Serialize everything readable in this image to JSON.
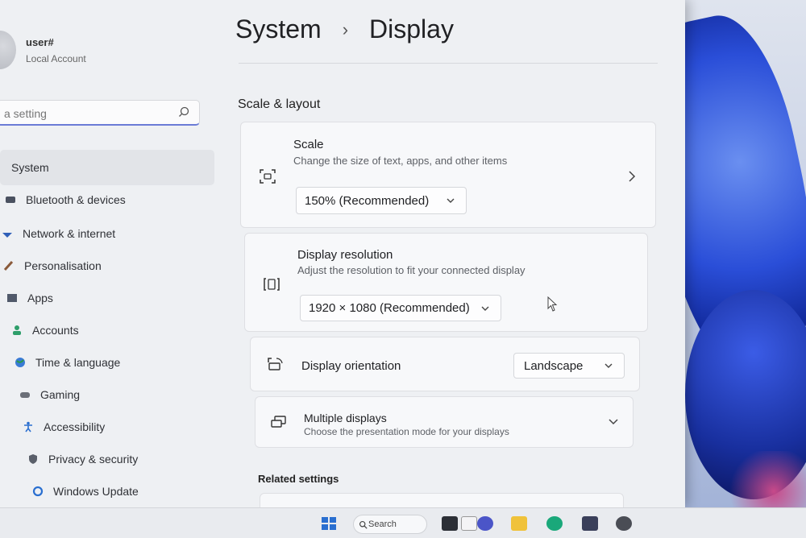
{
  "window": {
    "background": "#eef0f3"
  },
  "user": {
    "name": "user#",
    "account_type": "Local Account"
  },
  "search": {
    "placeholder": "Find a setting",
    "value": "a setting"
  },
  "nav": {
    "items": [
      {
        "label": "System",
        "icon": "monitor-icon",
        "active": true
      },
      {
        "label": "Bluetooth & devices",
        "icon": "bluetooth-icon"
      },
      {
        "label": "Network & internet",
        "icon": "wifi-icon"
      },
      {
        "label": "Personalisation",
        "icon": "brush-icon"
      },
      {
        "label": "Apps",
        "icon": "apps-icon"
      },
      {
        "label": "Accounts",
        "icon": "person-icon"
      },
      {
        "label": "Time & language",
        "icon": "globe-icon"
      },
      {
        "label": "Gaming",
        "icon": "gamepad-icon"
      },
      {
        "label": "Accessibility",
        "icon": "accessibility-icon"
      },
      {
        "label": "Privacy & security",
        "icon": "shield-icon"
      },
      {
        "label": "Windows Update",
        "icon": "update-icon"
      }
    ]
  },
  "header": {
    "parent": "System",
    "separator": "›",
    "title": "Display"
  },
  "section": {
    "scale_layout": "Scale & layout",
    "related": "Related settings"
  },
  "cards": {
    "scale": {
      "title": "Scale",
      "description": "Change the size of text, apps, and other items",
      "value": "150% (Recommended)"
    },
    "resolution": {
      "title": "Display resolution",
      "description": "Adjust the resolution to fit your connected display",
      "value": "1920 × 1080 (Recommended)"
    },
    "orientation": {
      "title": "Display orientation",
      "value": "Landscape"
    },
    "multiple": {
      "title": "Multiple displays",
      "description": "Choose the presentation mode for your displays"
    }
  },
  "taskbar": {
    "search_label": "Search"
  },
  "colors": {
    "accent": "#6a7bd6",
    "wallpaper_blue": "#2a4ed8"
  }
}
